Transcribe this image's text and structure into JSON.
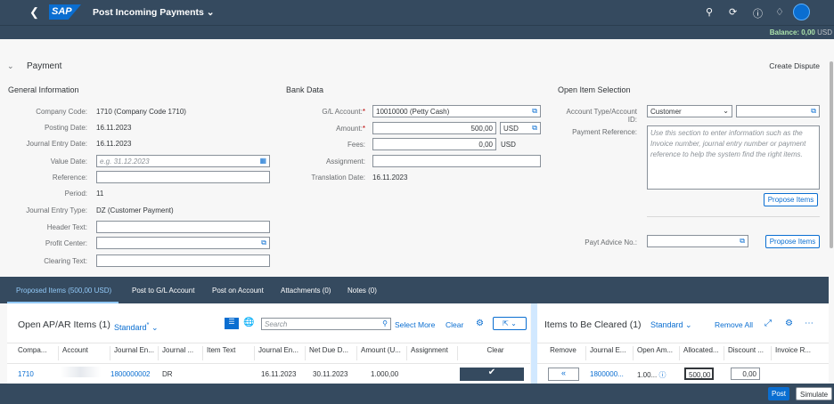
{
  "shell": {
    "logo": "SAP",
    "title": "Post Incoming Payments",
    "balance_label": "Balance: 0,00",
    "balance_currency": "USD"
  },
  "header": {
    "section": "Payment",
    "create_dispute": "Create Dispute"
  },
  "general": {
    "title": "General Information",
    "company_code_label": "Company Code:",
    "company_code": "1710 (Company Code 1710)",
    "posting_date_label": "Posting Date:",
    "posting_date": "16.11.2023",
    "journal_entry_date_label": "Journal Entry Date:",
    "journal_entry_date": "16.11.2023",
    "value_date_label": "Value Date:",
    "value_date_placeholder": "e.g. 31.12.2023",
    "reference_label": "Reference:",
    "period_label": "Period:",
    "period": "11",
    "je_type_label": "Journal Entry Type:",
    "je_type": "DZ (Customer Payment)",
    "header_text_label": "Header Text:",
    "profit_center_label": "Profit Center:",
    "clearing_text_label": "Clearing Text:"
  },
  "bank": {
    "title": "Bank Data",
    "gl_label": "G/L Account:",
    "gl_value": "10010000 (Petty Cash)",
    "amount_label": "Amount:",
    "amount": "500,00",
    "currency": "USD",
    "fees_label": "Fees:",
    "fees": "0,00",
    "fees_currency": "USD",
    "assignment_label": "Assignment:",
    "translation_label": "Translation Date:",
    "translation_date": "16.11.2023"
  },
  "open_item": {
    "title": "Open Item Selection",
    "account_type_label": "Account Type/Account ID:",
    "account_type": "Customer",
    "payment_ref_label": "Payment Reference:",
    "payment_ref_placeholder": "Use this section to enter information such as the Invoice number, journal entry number or payment reference to help the system find the right items.",
    "propose_items": "Propose Items",
    "payt_advice_label": "Payt Advice No.:",
    "propose_items_2": "Propose Items"
  },
  "tabs": [
    "Proposed Items (500,00 USD)",
    "Post to G/L Account",
    "Post on Account",
    "Attachments (0)",
    "Notes (0)"
  ],
  "left_table": {
    "title": "Open AP/AR Items",
    "count": "(1)",
    "variant": "Standard",
    "variant_mark": "*",
    "search_placeholder": "Search",
    "select_more": "Select More",
    "clear": "Clear",
    "columns": [
      "Compa...",
      "Account",
      "Journal En...",
      "Journal ...",
      "Item Text",
      "Journal En...",
      "Net Due D...",
      "Amount (U...",
      "Assignment",
      "Clear"
    ],
    "row": [
      "1710",
      "",
      "1800000002",
      "DR",
      "",
      "16.11.2023",
      "30.11.2023",
      "1.000,00",
      ""
    ]
  },
  "right_table": {
    "title": "Items to Be Cleared",
    "count": "(1)",
    "variant": "Standard",
    "remove_all": "Remove All",
    "columns": [
      "Remove",
      "Journal E...",
      "Open Am...",
      "Allocated...",
      "Discount ...",
      "Invoice R..."
    ],
    "row": [
      "",
      "1800000...",
      "1.00...",
      "500,00",
      "0,00",
      ""
    ]
  },
  "footer": {
    "post": "Post",
    "simulate": "Simulate"
  }
}
